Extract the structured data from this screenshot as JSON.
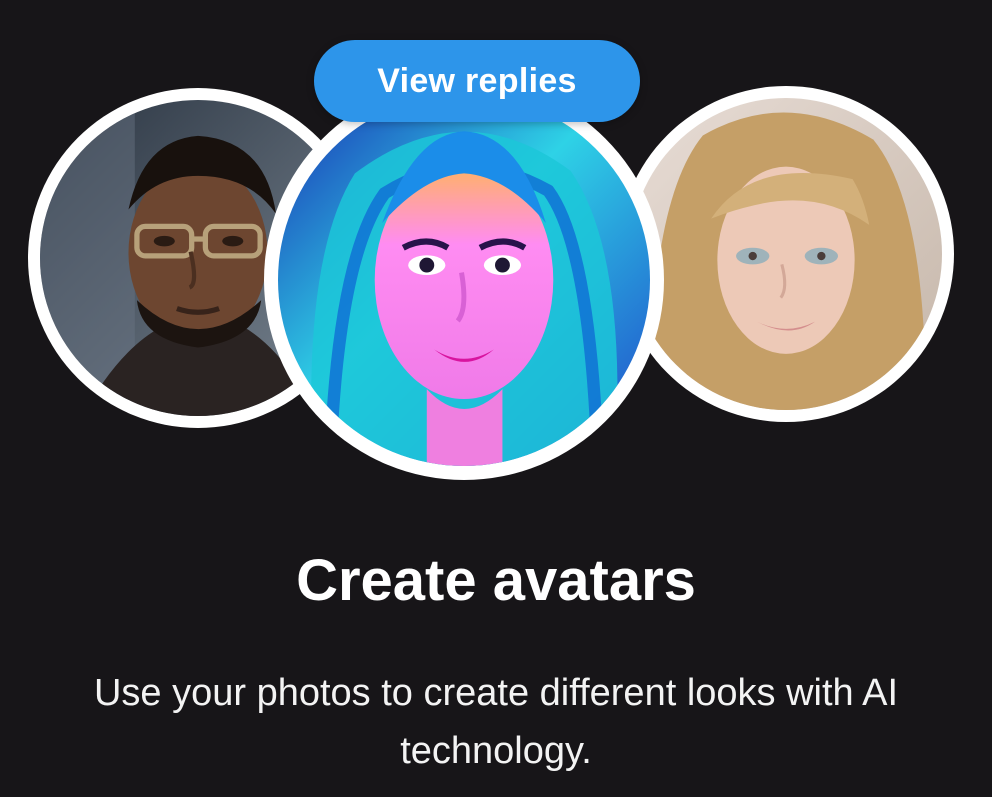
{
  "badge": {
    "view_replies_label": "View replies"
  },
  "headline": "Create avatars",
  "description": "Use your photos to create different looks with AI technology.",
  "colors": {
    "background": "#171518",
    "pill": "#2d95ea",
    "ring": "#ffffff",
    "text": "#ffffff"
  }
}
